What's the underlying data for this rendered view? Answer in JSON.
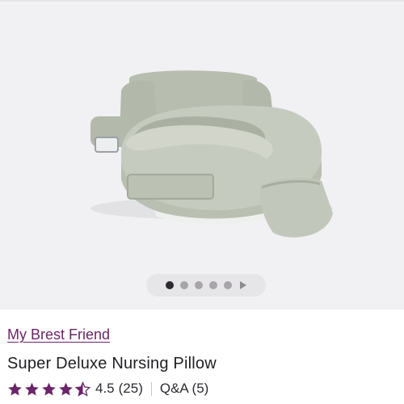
{
  "gallery": {
    "image_alt": "Super Deluxe Nursing Pillow",
    "active_slide": 1,
    "slide_count": 5
  },
  "product": {
    "brand": "My Brest Friend",
    "title": "Super Deluxe Nursing Pillow",
    "rating": 4.5,
    "rating_max": 5,
    "rating_text": "4.5",
    "review_count_text": "(25)",
    "qa_text": "Q&A (5)"
  },
  "colors": {
    "brand_link": "#6b2469",
    "star_fill": "#6b2469",
    "pillow": "#c6cbbf"
  }
}
